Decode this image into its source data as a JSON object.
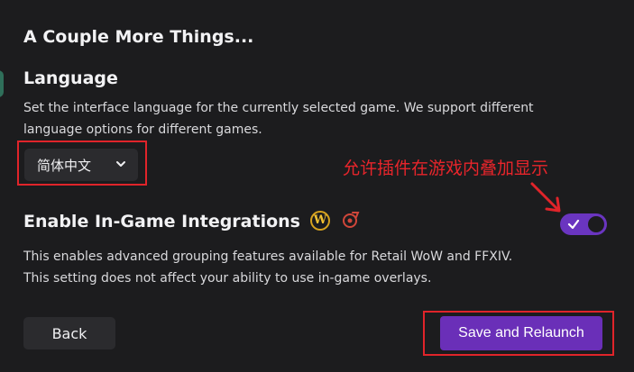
{
  "page": {
    "title": "A Couple More Things..."
  },
  "language": {
    "heading": "Language",
    "description_line1": "Set the interface language for the currently selected game. We support different",
    "description_line2": "language options for different games.",
    "selected": "简体中文"
  },
  "annotation": {
    "text": "允许插件在游戏内叠加显示"
  },
  "integrations": {
    "heading": "Enable In-Game Integrations",
    "description_line1": "This enables advanced grouping features available for Retail WoW and FFXIV.",
    "description_line2": "This setting does not affect your ability to use in-game overlays.",
    "enabled": true,
    "icons": [
      "wow-icon",
      "ffxiv-icon"
    ]
  },
  "actions": {
    "back_label": "Back",
    "save_label": "Save and Relaunch"
  },
  "colors": {
    "accent": "#6a2fb8",
    "annotation_red": "#e0242a",
    "background": "#1c1c1e"
  }
}
